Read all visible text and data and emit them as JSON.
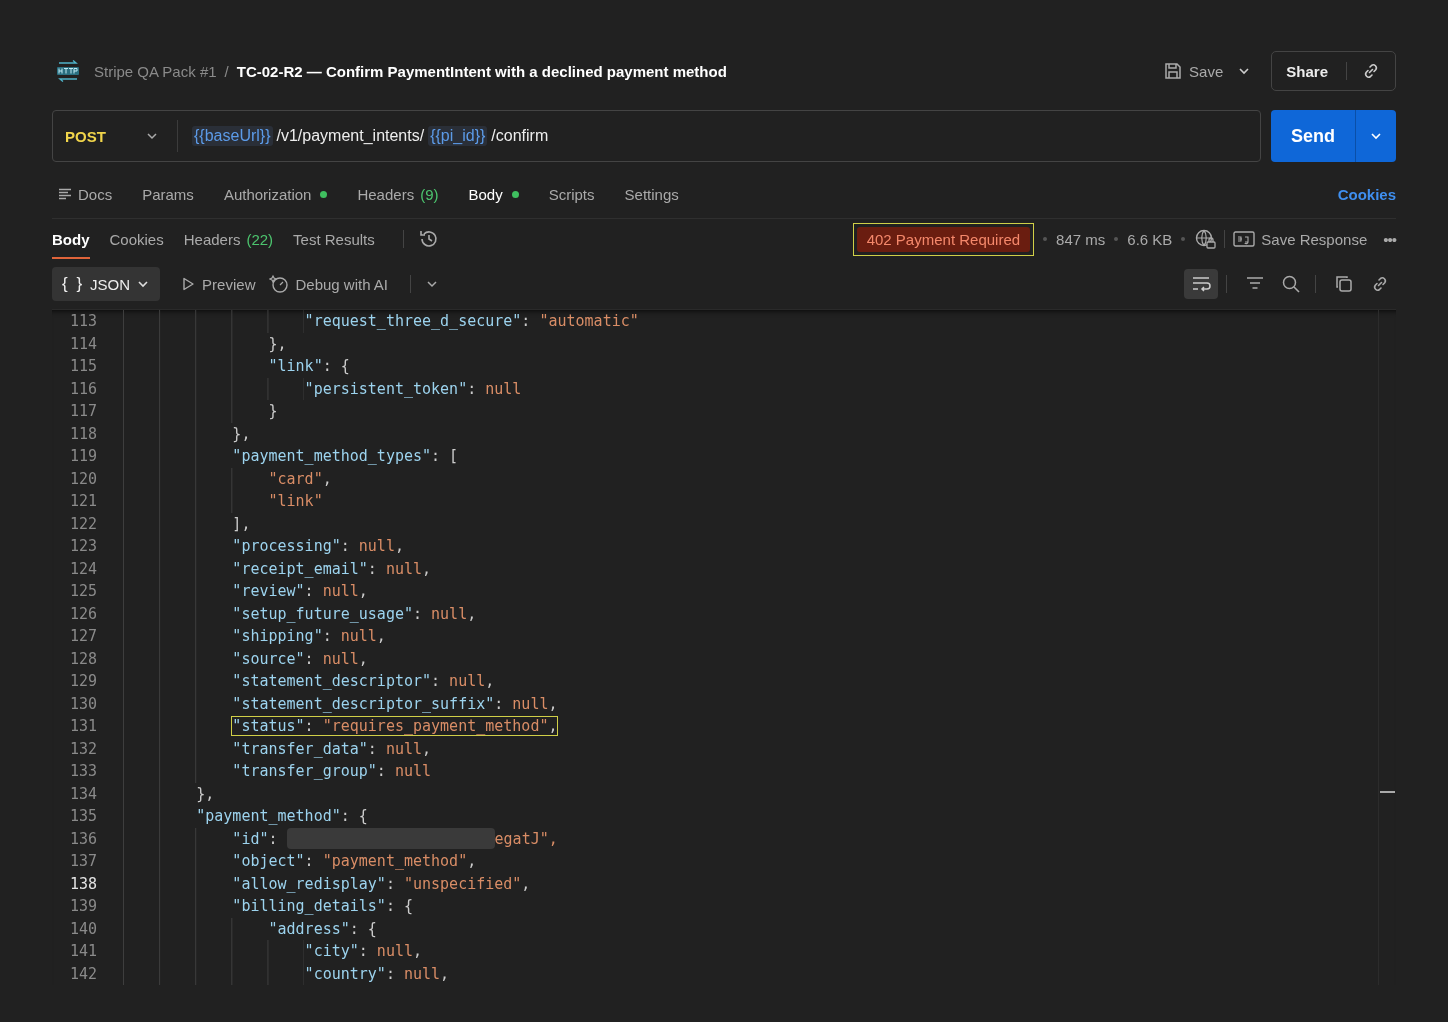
{
  "breadcrumb": {
    "collection": "Stripe QA Pack #1",
    "separator": "/",
    "title": "TC-02-R2 — Confirm PaymentIntent with a declined payment method"
  },
  "header_actions": {
    "save": "Save",
    "share": "Share"
  },
  "request": {
    "method": "POST",
    "url": [
      {
        "kind": "variable",
        "text": "{{baseUrl}}"
      },
      {
        "kind": "path",
        "text": "/v1/payment_intents/"
      },
      {
        "kind": "variable",
        "text": "{{pi_id}}"
      },
      {
        "kind": "path",
        "text": "/confirm"
      }
    ],
    "send": "Send"
  },
  "request_tabs": [
    {
      "label": "Docs",
      "kind": "docs",
      "selected": false,
      "dot": false
    },
    {
      "label": "Params",
      "kind": "tab",
      "selected": false,
      "dot": false
    },
    {
      "label": "Authorization",
      "kind": "tab",
      "selected": false,
      "dot": true
    },
    {
      "label": "Headers",
      "count": "(9)",
      "kind": "tab",
      "selected": false,
      "dot": false
    },
    {
      "label": "Body",
      "kind": "tab",
      "selected": true,
      "dot": true
    },
    {
      "label": "Scripts",
      "kind": "tab",
      "selected": false,
      "dot": false
    },
    {
      "label": "Settings",
      "kind": "tab",
      "selected": false,
      "dot": false
    }
  ],
  "cookies_link": "Cookies",
  "response_tabs": [
    {
      "label": "Body",
      "selected": true
    },
    {
      "label": "Cookies",
      "selected": false
    },
    {
      "label": "Headers",
      "count": "(22)",
      "selected": false
    },
    {
      "label": "Test Results",
      "selected": false
    }
  ],
  "response_meta": {
    "status": "402 Payment Required",
    "status_highlighted": true,
    "time": "847 ms",
    "size": "6.6 KB",
    "save_response": "Save Response",
    "more": "•••"
  },
  "body_toolbar": {
    "format_icon": "{ }",
    "format": "JSON",
    "preview": "Preview",
    "debug": "Debug with AI",
    "wrap_on": true
  },
  "code_lines": [
    {
      "number": "113",
      "text": "                    \"request_three_d_secure\": \"automatic\"",
      "highlighted": false,
      "current": false
    },
    {
      "number": "114",
      "text": "                },",
      "highlighted": false,
      "current": false
    },
    {
      "number": "115",
      "text": "                \"link\": {",
      "highlighted": false,
      "current": false
    },
    {
      "number": "116",
      "text": "                    \"persistent_token\": null",
      "highlighted": false,
      "current": false
    },
    {
      "number": "117",
      "text": "                }",
      "highlighted": false,
      "current": false
    },
    {
      "number": "118",
      "text": "            },",
      "highlighted": false,
      "current": false
    },
    {
      "number": "119",
      "text": "            \"payment_method_types\": [",
      "highlighted": false,
      "current": false
    },
    {
      "number": "120",
      "text": "                \"card\",",
      "highlighted": false,
      "current": false
    },
    {
      "number": "121",
      "text": "                \"link\"",
      "highlighted": false,
      "current": false
    },
    {
      "number": "122",
      "text": "            ],",
      "highlighted": false,
      "current": false
    },
    {
      "number": "123",
      "text": "            \"processing\": null,",
      "highlighted": false,
      "current": false
    },
    {
      "number": "124",
      "text": "            \"receipt_email\": null,",
      "highlighted": false,
      "current": false
    },
    {
      "number": "125",
      "text": "            \"review\": null,",
      "highlighted": false,
      "current": false
    },
    {
      "number": "126",
      "text": "            \"setup_future_usage\": null,",
      "highlighted": false,
      "current": false
    },
    {
      "number": "127",
      "text": "            \"shipping\": null,",
      "highlighted": false,
      "current": false
    },
    {
      "number": "128",
      "text": "            \"source\": null,",
      "highlighted": false,
      "current": false
    },
    {
      "number": "129",
      "text": "            \"statement_descriptor\": null,",
      "highlighted": false,
      "current": false
    },
    {
      "number": "130",
      "text": "            \"statement_descriptor_suffix\": null,",
      "highlighted": false,
      "current": false
    },
    {
      "number": "131",
      "text": "            \"status\": \"requires_payment_method\",",
      "highlighted": true,
      "current": false
    },
    {
      "number": "132",
      "text": "            \"transfer_data\": null,",
      "highlighted": false,
      "current": false
    },
    {
      "number": "133",
      "text": "            \"transfer_group\": null",
      "highlighted": false,
      "current": false
    },
    {
      "number": "134",
      "text": "        },",
      "highlighted": false,
      "current": false
    },
    {
      "number": "135",
      "text": "        \"payment_method\": {",
      "highlighted": false,
      "current": false
    },
    {
      "number": "136",
      "text": "            \"id\": ",
      "redacted_tail": "egatJ\",",
      "highlighted": false,
      "current": false
    },
    {
      "number": "137",
      "text": "            \"object\": \"payment_method\",",
      "highlighted": false,
      "current": false
    },
    {
      "number": "138",
      "text": "            \"allow_redisplay\": \"unspecified\",",
      "highlighted": false,
      "current": true
    },
    {
      "number": "139",
      "text": "            \"billing_details\": {",
      "highlighted": false,
      "current": false
    },
    {
      "number": "140",
      "text": "                \"address\": {",
      "highlighted": false,
      "current": false
    },
    {
      "number": "141",
      "text": "                    \"city\": null,",
      "highlighted": false,
      "current": false
    },
    {
      "number": "142",
      "text": "                    \"country\": null,",
      "highlighted": false,
      "current": false
    }
  ]
}
